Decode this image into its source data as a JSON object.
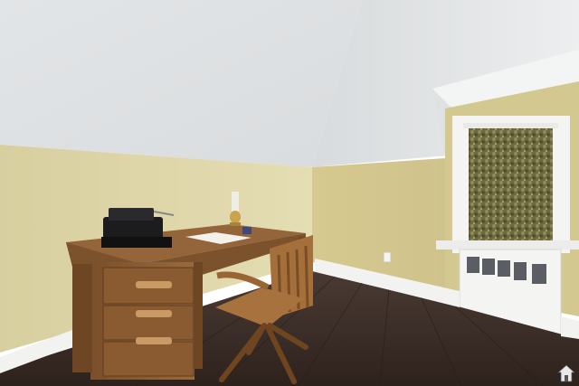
{
  "image": {
    "description_kind": "interior-photo",
    "room": "attic office",
    "colors": {
      "ceiling": "#e6e8e9",
      "wall": "#ddd4a6",
      "floor": "#3b2b24",
      "wood": "#8a5a30",
      "baseboard": "#f2f2f0",
      "radiator": "#f4f4f2"
    },
    "watermark": {
      "icon": "house-icon",
      "label": ""
    }
  }
}
